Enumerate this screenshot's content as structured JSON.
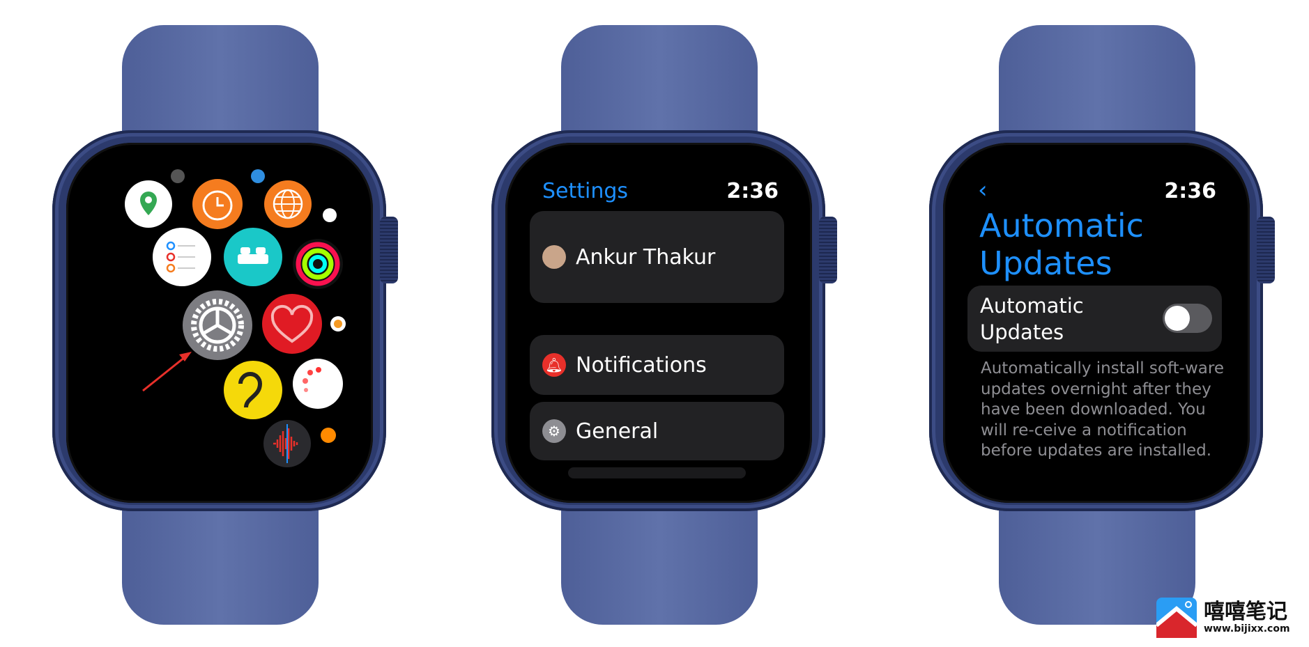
{
  "watch1": {
    "apps": [
      "maps",
      "alarms",
      "world-clock",
      "reminders",
      "sleep",
      "activity",
      "settings",
      "heart-rate",
      "noise",
      "timer",
      "voice-memos"
    ]
  },
  "watch2": {
    "title": "Settings",
    "time": "2:36",
    "profile_name": "Ankur Thakur",
    "items": [
      {
        "label": "Notifications",
        "icon": "bell-icon",
        "color": "#e8302a"
      },
      {
        "label": "General",
        "icon": "gear-icon",
        "color": "#8e8e93"
      }
    ]
  },
  "watch3": {
    "time": "2:36",
    "title_line1": "Automatic",
    "title_line2": "Updates",
    "toggle_label_line1": "Automatic",
    "toggle_label_line2": "Updates",
    "toggle_on": false,
    "description": "Automatically install soft-ware updates overnight after they have been downloaded. You will re-ceive a notification before updates are installed."
  },
  "colors": {
    "accent": "#1e90ff",
    "band": "#5b6ea6"
  },
  "logo": {
    "name": "嘻嘻笔记",
    "url": "www.bijixx.com"
  }
}
